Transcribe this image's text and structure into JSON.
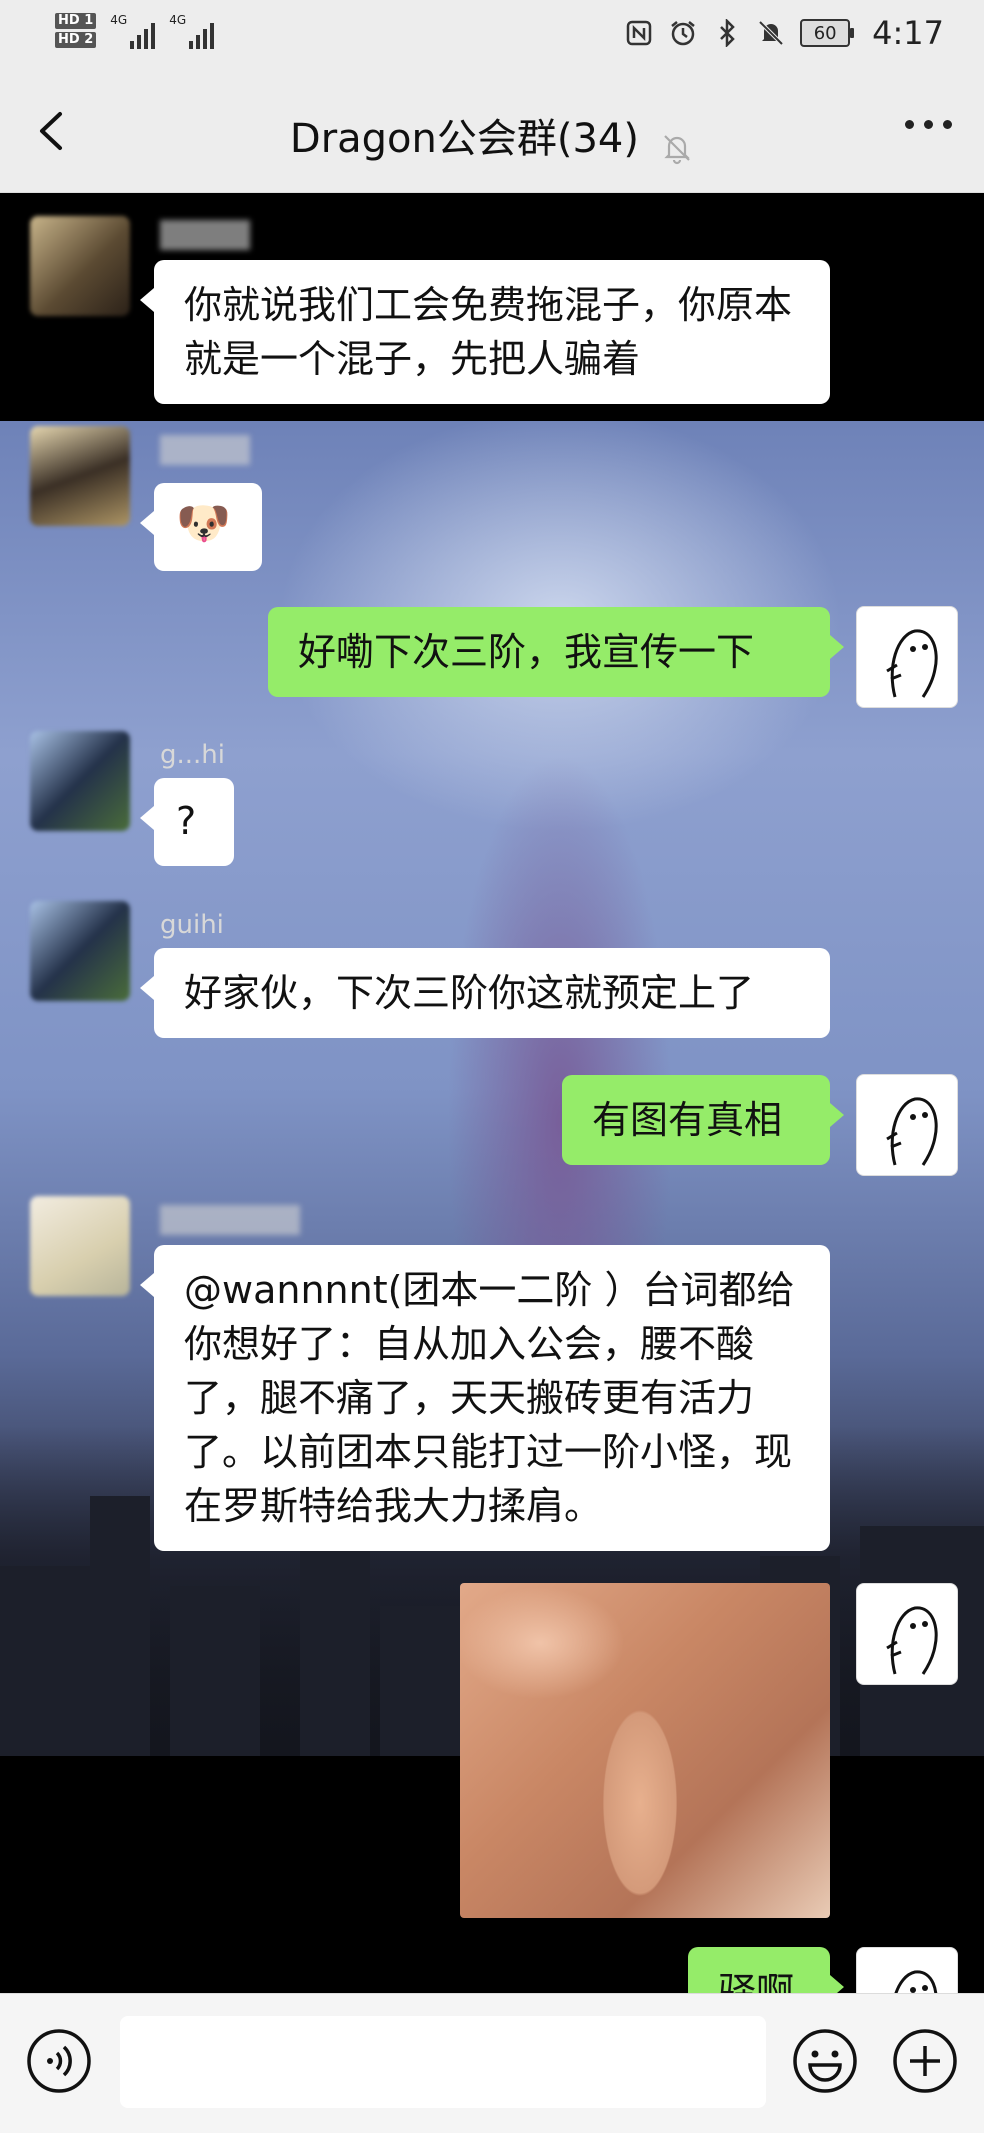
{
  "status_bar": {
    "sim1": "HD 1",
    "sim2": "HD 2",
    "net1": "4G",
    "net2": "4G",
    "battery": "60",
    "time": "4:17"
  },
  "header": {
    "title": "Dragon公会群(34)"
  },
  "messages": [
    {
      "side": "in",
      "sender": "",
      "text": "你就说我们工会免费拖混子，你原本就是一个混子，先把人骗着"
    },
    {
      "side": "in",
      "sender": "",
      "text": "🐶"
    },
    {
      "side": "out",
      "text": "好嘞下次三阶，我宣传一下"
    },
    {
      "side": "in",
      "sender": "g...hi",
      "text": "?"
    },
    {
      "side": "in",
      "sender": "guihi",
      "text": "好家伙，下次三阶你这就预定上了"
    },
    {
      "side": "out",
      "text": "有图有真相"
    },
    {
      "side": "in",
      "sender": "",
      "text": "@wannnnt(团本一二阶 ）台词都给你想好了：自从加入公会，腰不酸了，腿不痛了，天天搬砖更有活力了。以前团本只能打过一阶小怪，现在罗斯特给我大力揉肩。"
    },
    {
      "side": "out",
      "type": "image",
      "text": ""
    },
    {
      "side": "out",
      "text": "驿啊"
    }
  ],
  "input": {
    "value": ""
  },
  "icons": [
    "back-icon",
    "mute-icon",
    "more-icon",
    "voice-icon",
    "emoji-icon",
    "plus-icon"
  ]
}
